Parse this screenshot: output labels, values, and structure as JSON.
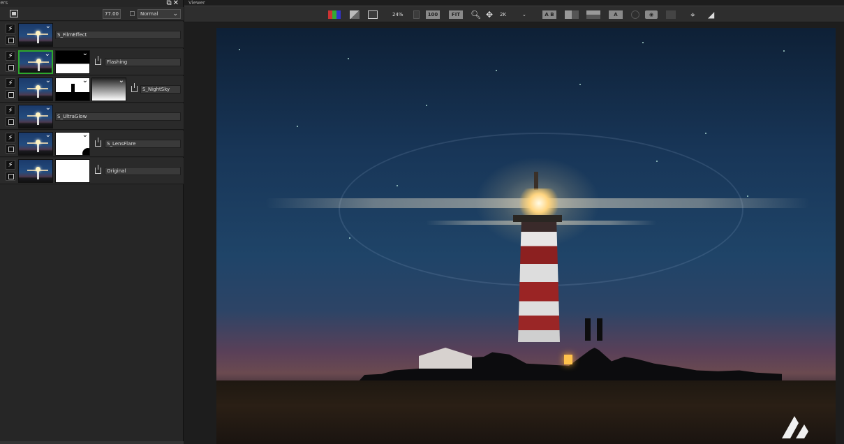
{
  "layers_panel": {
    "tab_title": "Layers",
    "window_controls": "⧉✕",
    "toolbar": {
      "opacity_value": "77.00",
      "blend_mode": "Normal"
    },
    "layers": [
      {
        "name": "S_FilmEffect",
        "has_mask": false,
        "selected": false
      },
      {
        "name": "Flashing",
        "has_mask": true,
        "selected": true
      },
      {
        "name": "S_NightSky",
        "has_mask": true,
        "selected": false
      },
      {
        "name": "S_UltraGlow",
        "has_mask": false,
        "selected": false
      },
      {
        "name": "S_LensFlare",
        "has_mask": true,
        "selected": false
      },
      {
        "name": "Original",
        "has_mask": true,
        "selected": false
      }
    ]
  },
  "viewer": {
    "tab_title": "Viewer",
    "toolbar": {
      "zoom_percent": "24%",
      "zoom_100": "100",
      "zoom_fit": "FIT",
      "resolution": "2K",
      "compare_label": "A B",
      "overlay_label": "A"
    }
  }
}
